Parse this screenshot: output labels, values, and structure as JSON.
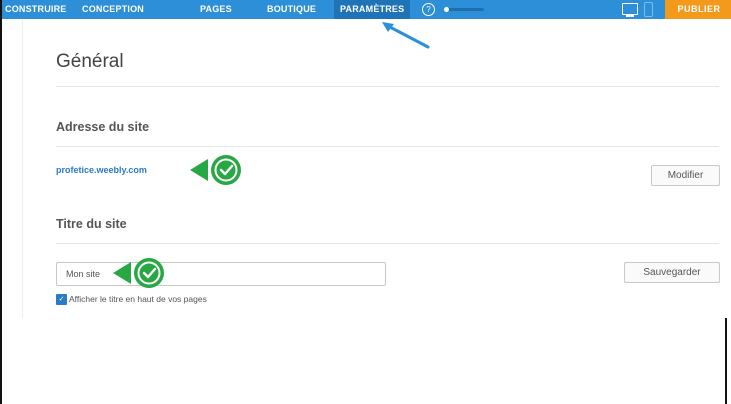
{
  "nav": {
    "items": [
      {
        "label": "CONSTRUIRE"
      },
      {
        "label": "CONCEPTION"
      },
      {
        "label": "PAGES"
      },
      {
        "label": "BOUTIQUE"
      },
      {
        "label": "PARAMÈTRES"
      }
    ],
    "help_label": "?",
    "publish_label": "PUBLIER"
  },
  "icons": [
    "help-icon",
    "desktop-icon",
    "mobile-icon",
    "check-icon",
    "arrow-icon"
  ],
  "colors": {
    "topbar": "#2c8fd8",
    "active_tab": "#1f74b8",
    "publish": "#f39a1c",
    "badge": "#27a844",
    "link": "#2a7cc7"
  },
  "page": {
    "title": "Général"
  },
  "site_address": {
    "heading": "Adresse du site",
    "url": "profetice.weebly.com",
    "modify_label": "Modifier"
  },
  "site_title": {
    "heading": "Titre du site",
    "value": "Mon site",
    "save_label": "Sauvegarder",
    "show_title_label": "Afficher le titre en haut de vos pages",
    "show_title_checked": true
  }
}
